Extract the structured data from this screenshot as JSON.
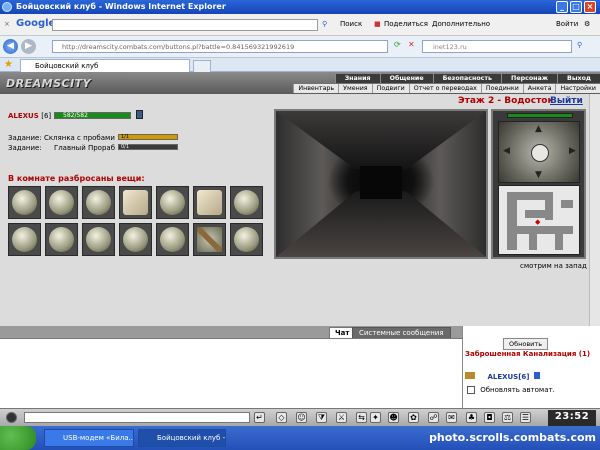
{
  "window": {
    "title": "Бойцовский клуб - Windows Internet Explorer"
  },
  "google_toolbar": {
    "brand": "Google",
    "search_label": "Поиск",
    "share_label": "Поделиться",
    "more_label": "Дополнительно",
    "login_label": "Войти"
  },
  "address_bar": {
    "url": "http://dreamscity.combats.com/buttons.pl?battle=0.841569321992619",
    "search_placeholder": "inet123.ru"
  },
  "tab": {
    "title": "Бойцовский клуб"
  },
  "game_header": {
    "logo": "DREAMSCITY",
    "menu_top": [
      "Знания",
      "Общение",
      "Безопасность",
      "Персонаж",
      "Выход"
    ],
    "menu_bottom": [
      "Инвентарь",
      "Умения",
      "Подвиги",
      "Отчет о переводах",
      "Поединки",
      "Анкета",
      "Настройки"
    ]
  },
  "character": {
    "name": "ALEXUS",
    "level": "[6]",
    "hp_text": "582/582",
    "hp_fraction": 1.0
  },
  "tasks": [
    {
      "label": "Задание:",
      "name": "Склянка с пробами",
      "progress_text": "1/1",
      "fraction": 1.0,
      "color": "#d19a00"
    },
    {
      "label": "Задание:",
      "name": "Главный Прораб",
      "progress_text": "0/1",
      "fraction": 0.0,
      "color": "#3a3a3a"
    }
  ],
  "items_title": "В комнате разбросаны вещи:",
  "items": [
    [
      "coin",
      "coin",
      "ring",
      "scroll",
      "coin",
      "scroll",
      "coin"
    ],
    [
      "coin",
      "coin",
      "ring",
      "coin",
      "ring",
      "stick",
      "ring"
    ]
  ],
  "room": {
    "title": "Этаж 2 - Водосток",
    "exit_label": "Выйти",
    "direction_text": "смотрим на запад"
  },
  "chat": {
    "tab_chat": "Чат",
    "tab_system": "Системные сообщения"
  },
  "right_panel": {
    "refresh_label": "Обновить",
    "location": "Заброшенная Канализация (1)",
    "player": "ALEXUS[6]",
    "auto_refresh_label": "Обновлять автомат."
  },
  "bottom_toolbar": {
    "clock": "23:52"
  },
  "taskbar": {
    "items": [
      "USB-модем «Била...",
      "Бойцовский клуб - ..."
    ],
    "watermark": "photo.scrolls.combats.com"
  },
  "colors": {
    "accent_red": "#b00000",
    "link_blue": "#1a3aa0",
    "hp_green": "#1a8a1a"
  }
}
